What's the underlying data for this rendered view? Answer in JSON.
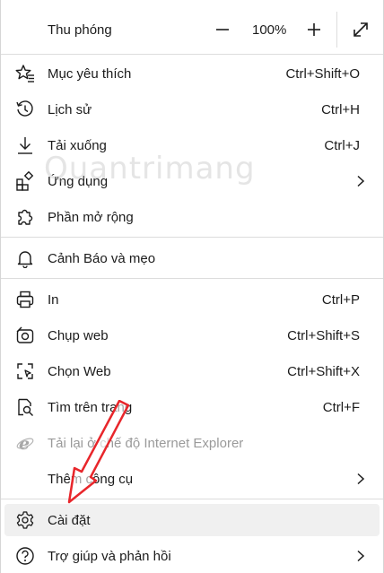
{
  "zoom": {
    "label": "Thu phóng",
    "minus_icon": "minus-icon",
    "value": "100%",
    "plus_icon": "plus-icon",
    "fullscreen_icon": "expand-icon"
  },
  "items": [
    {
      "label": "Mục yêu thích",
      "shortcut": "Ctrl+Shift+O",
      "icon": "favorites-icon"
    },
    {
      "label": "Lịch sử",
      "shortcut": "Ctrl+H",
      "icon": "history-icon"
    },
    {
      "label": "Tải xuống",
      "shortcut": "Ctrl+J",
      "icon": "download-icon"
    },
    {
      "label": "Ứng dụng",
      "shortcut": "",
      "icon": "apps-icon"
    },
    {
      "label": "Phần mở rộng",
      "shortcut": "",
      "icon": "extensions-icon"
    },
    {
      "label": "Cảnh Báo và mẹo",
      "shortcut": "",
      "icon": "bell-icon"
    },
    {
      "label": "In",
      "shortcut": "Ctrl+P",
      "icon": "printer-icon"
    },
    {
      "label": "Chụp web",
      "shortcut": "Ctrl+Shift+S",
      "icon": "screenshot-icon"
    },
    {
      "label": "Chọn Web",
      "shortcut": "Ctrl+Shift+X",
      "icon": "web-select-icon"
    },
    {
      "label": "Tìm trên trang",
      "shortcut": "Ctrl+F",
      "icon": "find-icon"
    },
    {
      "label": "Tải lại ở chế độ Internet Explorer",
      "shortcut": "",
      "icon": "ie-icon"
    },
    {
      "label": "Thêm công cụ",
      "shortcut": "",
      "icon": ""
    },
    {
      "label": "Cài đặt",
      "shortcut": "",
      "icon": "gear-icon"
    },
    {
      "label": "Trợ giúp và phản hồi",
      "shortcut": "",
      "icon": "help-icon"
    }
  ],
  "watermark": "Quantrimang",
  "colors": {
    "highlight": "#f0f0f0",
    "arrow": "#e8262b",
    "divider": "#dcdcdc"
  }
}
